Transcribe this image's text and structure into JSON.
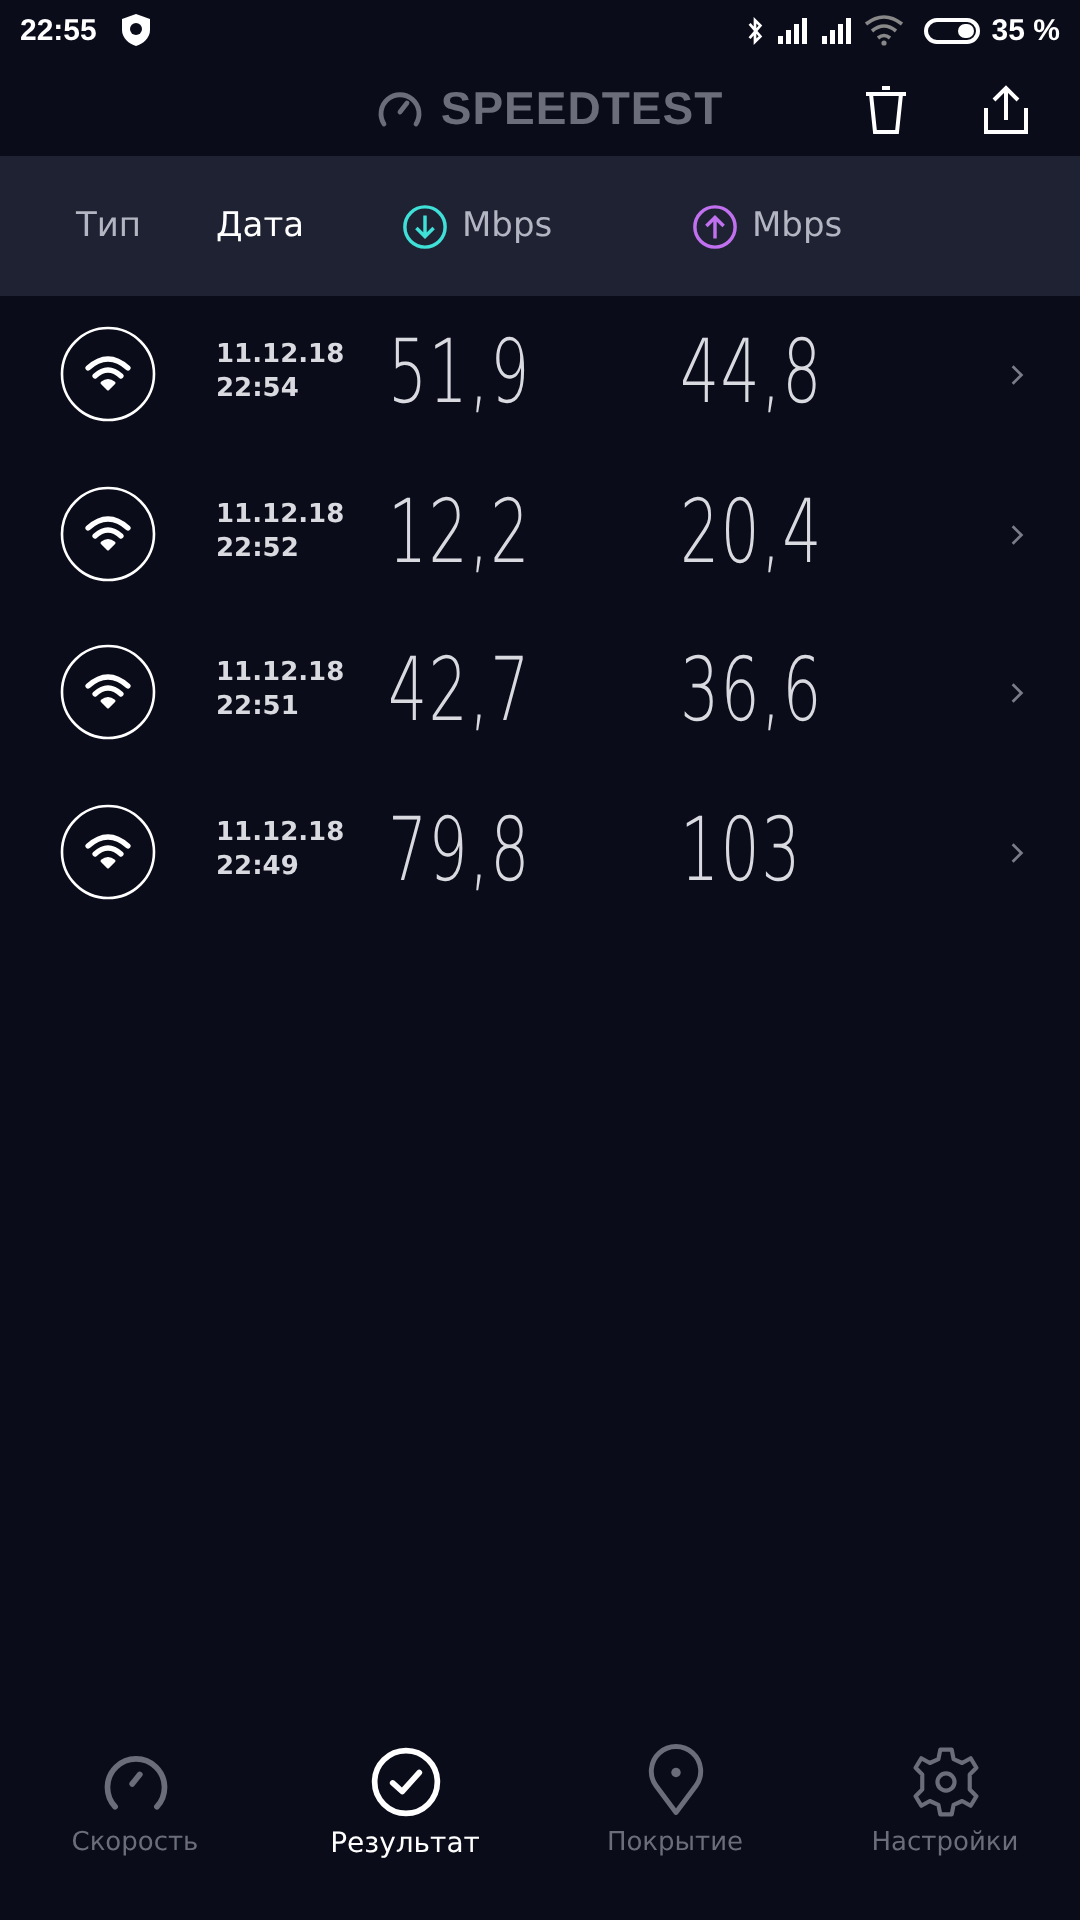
{
  "status_bar": {
    "time": "22:55",
    "battery_text": "35 %"
  },
  "app_bar": {
    "title": "SPEEDTEST"
  },
  "columns": [
    {
      "label": "Тип",
      "kind": "text",
      "selected": false
    },
    {
      "label": "Дата",
      "kind": "text",
      "selected": true
    },
    {
      "label": "Mbps",
      "kind": "download",
      "selected": false
    },
    {
      "label": "Mbps",
      "kind": "upload",
      "selected": false
    }
  ],
  "results": [
    {
      "date": "11.12.18",
      "time": "22:54",
      "download": "51,9",
      "upload": "44,8"
    },
    {
      "date": "11.12.18",
      "time": "22:52",
      "download": "12,2",
      "upload": "20,4"
    },
    {
      "date": "11.12.18",
      "time": "22:51",
      "download": "42,7",
      "upload": "36,6"
    },
    {
      "date": "11.12.18",
      "time": "22:49",
      "download": "79,8",
      "upload": "103"
    }
  ],
  "nav": [
    {
      "label": "Скорость",
      "kind": "speed",
      "selected": false
    },
    {
      "label": "Результат",
      "kind": "results",
      "selected": true
    },
    {
      "label": "Покрытие",
      "kind": "coverage",
      "selected": false
    },
    {
      "label": "Настройки",
      "kind": "settings",
      "selected": false
    }
  ]
}
